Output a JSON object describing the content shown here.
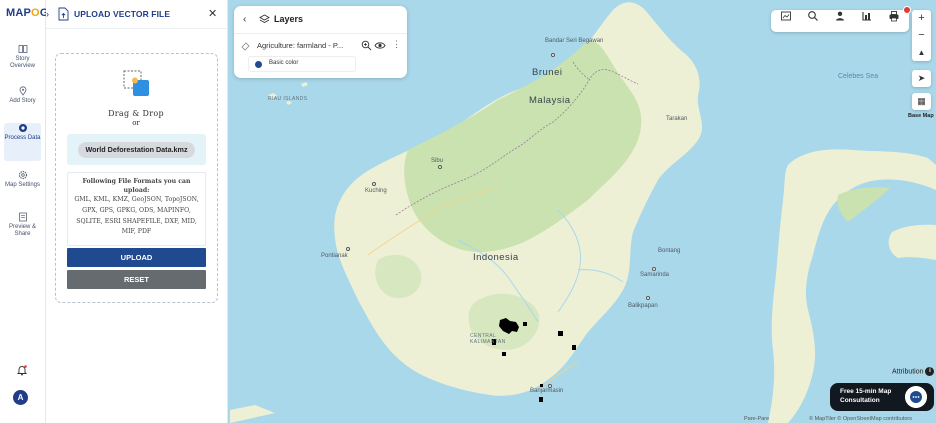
{
  "brand": {
    "logo_left": "MAP",
    "logo_o": "O",
    "logo_right": "G"
  },
  "nav": {
    "items": [
      {
        "label": "Story Overview"
      },
      {
        "label": "Add Story"
      },
      {
        "label": "Process Data"
      },
      {
        "label": "Map Settings"
      },
      {
        "label": "Preview & Share"
      }
    ],
    "avatar_letter": "A"
  },
  "panel": {
    "title": "UPLOAD VECTOR FILE",
    "drag_drop": "Drag & Drop",
    "or": "or",
    "file_name": "World Deforestation Data.kmz",
    "formats_title": "Following File Formats you can upload:",
    "formats_list": "GML, KML, KMZ, GeoJSON, TopoJSON, GPX, GPS, GPKG, ODS, MAPINFO, SQLITE, ESRI SHAPEFILE, DXF, MID, MIF, PDF",
    "upload_label": "UPLOAD",
    "reset_label": "RESET"
  },
  "layers": {
    "title": "Layers",
    "layer_name": "Agriculture: farmland - P...",
    "style_label": "Basic color",
    "style_color": "#234a8f"
  },
  "map": {
    "labels": {
      "bandar": "Bandar Seri Begawan",
      "brunei": "Brunei",
      "malaysia": "Malaysia",
      "celebes": "Celebes Sea",
      "tarakan": "Tarakan",
      "riau": "RIAU ISLANDS",
      "sibu": "Sibu",
      "kuching": "Kuching",
      "indonesia": "Indonesia",
      "pontianak": "Pontianak",
      "bontang": "Bontang",
      "samarinda": "Samarinda",
      "balikpapan": "Balikpapan",
      "central": "CENTRAL KALIMANTAN",
      "banjarmasin": "Banjarmasin",
      "pawpare": "Pare-Pare"
    },
    "basemap_label": "Base Map",
    "attribution": "Attribution",
    "consult": "Free 15-min Map Consultation",
    "copyright": "© MapTiler © OpenStreetMap contributors"
  },
  "colors": {
    "brand_blue": "#1f3d8a",
    "upload_blue": "#1f4a8f",
    "reset_gray": "#666b70",
    "land": "#eef0d6",
    "sea": "#a9d8ea",
    "forest": "#c9e2b0"
  }
}
